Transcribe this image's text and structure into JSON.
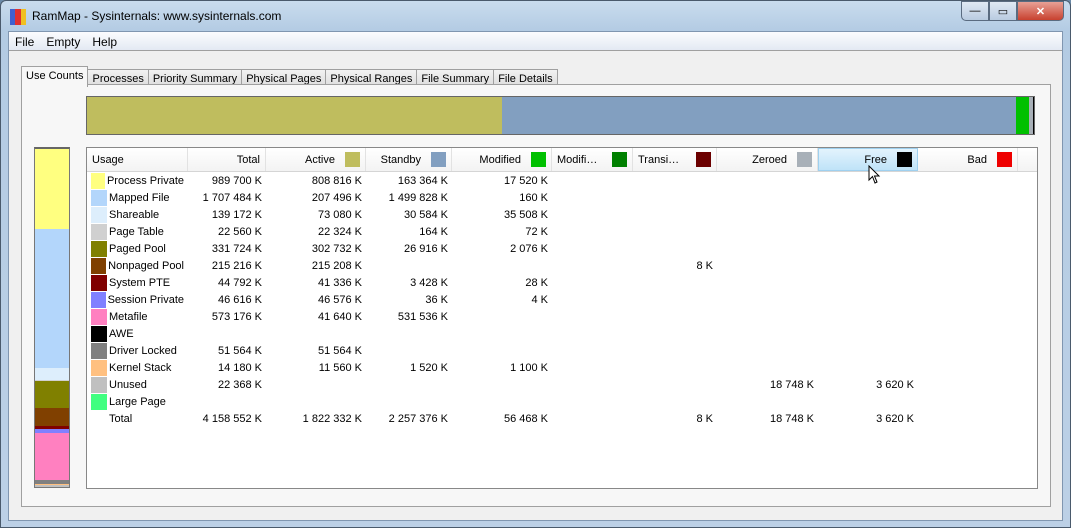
{
  "window": {
    "title": "RamMap - Sysinternals: www.sysinternals.com",
    "minimize": "—",
    "maximize": "▭",
    "close": "✕"
  },
  "menu": [
    "File",
    "Empty",
    "Help"
  ],
  "tabs": [
    "Use Counts",
    "Processes",
    "Priority Summary",
    "Physical Pages",
    "Physical Ranges",
    "File Summary",
    "File Details"
  ],
  "columns": [
    {
      "label": "Usage",
      "color": null
    },
    {
      "label": "Total",
      "color": null
    },
    {
      "label": "Active",
      "color": "#bfbd5e"
    },
    {
      "label": "Standby",
      "color": "#829fc0"
    },
    {
      "label": "Modified",
      "color": "#00c000"
    },
    {
      "label": "Modifi…",
      "color": "#008000"
    },
    {
      "label": "Transi…",
      "color": "#6b0000"
    },
    {
      "label": "Zeroed",
      "color": "#a8b0b8"
    },
    {
      "label": "Free",
      "color": "#000000"
    },
    {
      "label": "Bad",
      "color": "#ee0000"
    }
  ],
  "rows": [
    {
      "usage": "Process Private",
      "color": "#ffff80",
      "values": [
        "989 700 K",
        "808 816 K",
        "163 364 K",
        "17 520 K",
        "",
        "",
        "",
        "",
        ""
      ],
      "kb": 989700
    },
    {
      "usage": "Mapped File",
      "color": "#b3d6fb",
      "values": [
        "1 707 484 K",
        "207 496 K",
        "1 499 828 K",
        "160 K",
        "",
        "",
        "",
        "",
        ""
      ],
      "kb": 1707484
    },
    {
      "usage": "Shareable",
      "color": "#ddeefc",
      "values": [
        "139 172 K",
        "73 080 K",
        "30 584 K",
        "35 508 K",
        "",
        "",
        "",
        "",
        ""
      ],
      "kb": 139172
    },
    {
      "usage": "Page Table",
      "color": "#d0d0d0",
      "values": [
        "22 560 K",
        "22 324 K",
        "164 K",
        "72 K",
        "",
        "",
        "",
        "",
        ""
      ],
      "kb": 22560
    },
    {
      "usage": "Paged Pool",
      "color": "#808000",
      "values": [
        "331 724 K",
        "302 732 K",
        "26 916 K",
        "2 076 K",
        "",
        "",
        "",
        "",
        ""
      ],
      "kb": 331724
    },
    {
      "usage": "Nonpaged Pool",
      "color": "#804000",
      "values": [
        "215 216 K",
        "215 208 K",
        "",
        "",
        "",
        "8 K",
        "",
        "",
        ""
      ],
      "kb": 215216
    },
    {
      "usage": "System PTE",
      "color": "#800000",
      "values": [
        "44 792 K",
        "41 336 K",
        "3 428 K",
        "28 K",
        "",
        "",
        "",
        "",
        ""
      ],
      "kb": 44792
    },
    {
      "usage": "Session Private",
      "color": "#8080ff",
      "values": [
        "46 616 K",
        "46 576 K",
        "36 K",
        "4 K",
        "",
        "",
        "",
        "",
        ""
      ],
      "kb": 46616
    },
    {
      "usage": "Metafile",
      "color": "#ff80c0",
      "values": [
        "573 176 K",
        "41 640 K",
        "531 536 K",
        "",
        "",
        "",
        "",
        "",
        ""
      ],
      "kb": 573176
    },
    {
      "usage": "AWE",
      "color": "#000000",
      "values": [
        "",
        "",
        "",
        "",
        "",
        "",
        "",
        "",
        ""
      ],
      "kb": 0
    },
    {
      "usage": "Driver Locked",
      "color": "#808080",
      "values": [
        "51 564 K",
        "51 564 K",
        "",
        "",
        "",
        "",
        "",
        "",
        ""
      ],
      "kb": 51564
    },
    {
      "usage": "Kernel Stack",
      "color": "#ffc080",
      "values": [
        "14 180 K",
        "11 560 K",
        "1 520 K",
        "1 100 K",
        "",
        "",
        "",
        "",
        ""
      ],
      "kb": 14180
    },
    {
      "usage": "Unused",
      "color": "#c0c0c0",
      "values": [
        "22 368 K",
        "",
        "",
        "",
        "",
        "",
        "18 748 K",
        "3 620 K",
        ""
      ],
      "kb": 22368
    },
    {
      "usage": "Large Page",
      "color": "#40ff80",
      "values": [
        "",
        "",
        "",
        "",
        "",
        "",
        "",
        "",
        ""
      ],
      "kb": 0
    }
  ],
  "total": {
    "usage": "Total",
    "values": [
      "4 158 552 K",
      "1 822 332 K",
      "2 257 376 K",
      "56 468 K",
      "",
      "8 K",
      "18 748 K",
      "3 620 K",
      ""
    ]
  },
  "state_totals_kb": {
    "active": 1822332,
    "standby": 2257376,
    "modified": 56468,
    "modified_no_write": 0,
    "transition": 8,
    "zeroed": 18748,
    "free": 3620,
    "bad": 0
  }
}
